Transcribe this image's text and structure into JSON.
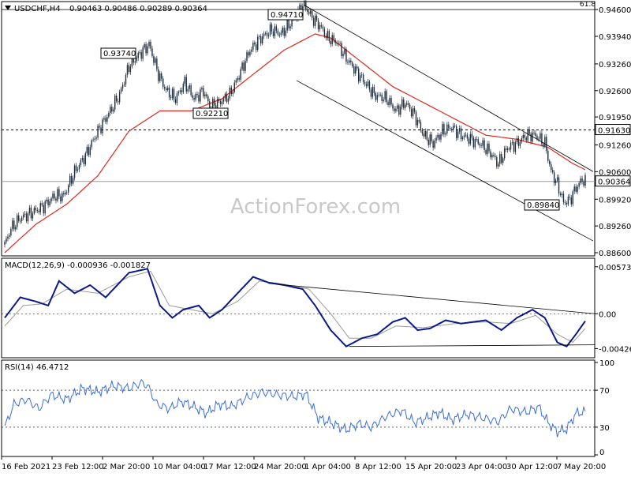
{
  "header": {
    "symbol": "USDCHF,H4",
    "ohlc": "0.90463 0.90486 0.90289 0.90364"
  },
  "watermark": "ActionForex.com",
  "colors": {
    "candles": "#1f2d3d",
    "ma": "#e0281e",
    "macd": "#0b1a8a",
    "signal": "#9a9a9a",
    "rsi": "#3a6fd8",
    "trend": "#000000",
    "grid": "#000000"
  },
  "price_panel": {
    "y_ticks": [
      "0.94600",
      "0.93940",
      "0.93260",
      "0.92600",
      "0.91950",
      "0.91260",
      "0.90600",
      "0.89920",
      "0.89260",
      "0.88600"
    ],
    "current_price": "0.90364",
    "level_label": "0.91630",
    "fib_label": "61.8",
    "annotations": [
      "0.94710",
      "0.93740",
      "0.92210",
      "0.89840"
    ]
  },
  "macd_panel": {
    "label": "MACD(12,26,9) -0.000936 -0.001827",
    "y_ticks": [
      "0.005739",
      "0.00",
      "-0.004261"
    ]
  },
  "rsi_panel": {
    "label": "RSI(14) 46.4712",
    "y_ticks": [
      "100",
      "70",
      "30",
      "0"
    ]
  },
  "x_labels": [
    "16 Feb 2021",
    "23 Feb 12:00",
    "2 Mar 20:00",
    "10 Mar 04:00",
    "17 Mar 12:00",
    "24 Mar 20:00",
    "1 Apr 04:00",
    "8 Apr 12:00",
    "15 Apr 20:00",
    "23 Apr 04:00",
    "30 Apr 12:00",
    "7 May 20:00"
  ],
  "chart_data": {
    "type": "candlestick",
    "price_axis": {
      "min": 0.886,
      "max": 0.9471
    },
    "price_anchors": [
      [
        0,
        0.888
      ],
      [
        4,
        0.892
      ],
      [
        10,
        0.8945
      ],
      [
        18,
        0.896
      ],
      [
        25,
        0.8975
      ],
      [
        32,
        0.9
      ],
      [
        38,
        0.9
      ],
      [
        45,
        0.906
      ],
      [
        52,
        0.91
      ],
      [
        60,
        0.916
      ],
      [
        68,
        0.921
      ],
      [
        74,
        0.925
      ],
      [
        80,
        0.932
      ],
      [
        88,
        0.9355
      ],
      [
        93,
        0.9374
      ],
      [
        99,
        0.93
      ],
      [
        104,
        0.926
      ],
      [
        110,
        0.924
      ],
      [
        116,
        0.928
      ],
      [
        122,
        0.924
      ],
      [
        128,
        0.926
      ],
      [
        132,
        0.9221
      ],
      [
        138,
        0.923
      ],
      [
        145,
        0.925
      ],
      [
        150,
        0.929
      ],
      [
        158,
        0.936
      ],
      [
        165,
        0.939
      ],
      [
        172,
        0.941
      ],
      [
        178,
        0.94
      ],
      [
        185,
        0.943
      ],
      [
        190,
        0.946
      ],
      [
        193,
        0.9471
      ],
      [
        198,
        0.944
      ],
      [
        203,
        0.942
      ],
      [
        208,
        0.939
      ],
      [
        214,
        0.938
      ],
      [
        220,
        0.934
      ],
      [
        226,
        0.931
      ],
      [
        232,
        0.928
      ],
      [
        238,
        0.925
      ],
      [
        246,
        0.924
      ],
      [
        252,
        0.921
      ],
      [
        258,
        0.923
      ],
      [
        264,
        0.92
      ],
      [
        270,
        0.915
      ],
      [
        276,
        0.913
      ],
      [
        282,
        0.916
      ],
      [
        288,
        0.917
      ],
      [
        294,
        0.915
      ],
      [
        300,
        0.914
      ],
      [
        306,
        0.913
      ],
      [
        312,
        0.911
      ],
      [
        318,
        0.908
      ],
      [
        324,
        0.912
      ],
      [
        330,
        0.913
      ],
      [
        336,
        0.915
      ],
      [
        342,
        0.915
      ],
      [
        348,
        0.913
      ],
      [
        352,
        0.906
      ],
      [
        356,
        0.903
      ],
      [
        360,
        0.8984
      ],
      [
        364,
        0.899
      ],
      [
        368,
        0.902
      ],
      [
        372,
        0.904
      ],
      [
        374,
        0.9036
      ]
    ],
    "moving_average_anchors": [
      [
        0,
        0.886
      ],
      [
        20,
        0.893
      ],
      [
        40,
        0.898
      ],
      [
        60,
        0.905
      ],
      [
        80,
        0.916
      ],
      [
        100,
        0.921
      ],
      [
        120,
        0.921
      ],
      [
        140,
        0.924
      ],
      [
        160,
        0.93
      ],
      [
        180,
        0.936
      ],
      [
        200,
        0.94
      ],
      [
        210,
        0.939
      ],
      [
        230,
        0.933
      ],
      [
        250,
        0.927
      ],
      [
        270,
        0.923
      ],
      [
        290,
        0.919
      ],
      [
        310,
        0.915
      ],
      [
        330,
        0.914
      ],
      [
        350,
        0.912
      ],
      [
        366,
        0.908
      ],
      [
        374,
        0.9065
      ]
    ],
    "horizontal_levels": [
      0.9163,
      0.9036,
      0.946
    ],
    "macd_axis": {
      "min": -0.004261,
      "max": 0.005739
    },
    "macd_anchors": [
      [
        0,
        -0.0005
      ],
      [
        10,
        0.002
      ],
      [
        20,
        0.0015
      ],
      [
        28,
        0.001
      ],
      [
        35,
        0.004
      ],
      [
        45,
        0.0025
      ],
      [
        55,
        0.0035
      ],
      [
        65,
        0.002
      ],
      [
        80,
        0.005
      ],
      [
        92,
        0.0055
      ],
      [
        100,
        0.001
      ],
      [
        108,
        -0.0005
      ],
      [
        115,
        0.0005
      ],
      [
        125,
        0.001
      ],
      [
        132,
        -0.0005
      ],
      [
        140,
        0.0005
      ],
      [
        150,
        0.0025
      ],
      [
        160,
        0.0045
      ],
      [
        170,
        0.0038
      ],
      [
        180,
        0.0035
      ],
      [
        192,
        0.003
      ],
      [
        200,
        0.001
      ],
      [
        210,
        -0.002
      ],
      [
        220,
        -0.004
      ],
      [
        230,
        -0.003
      ],
      [
        240,
        -0.0025
      ],
      [
        250,
        -0.001
      ],
      [
        258,
        -0.0005
      ],
      [
        266,
        -0.002
      ],
      [
        274,
        -0.0018
      ],
      [
        284,
        -0.0008
      ],
      [
        294,
        -0.0012
      ],
      [
        302,
        -0.001
      ],
      [
        310,
        -0.0008
      ],
      [
        320,
        -0.002
      ],
      [
        330,
        -0.0005
      ],
      [
        340,
        0.0005
      ],
      [
        348,
        -0.0005
      ],
      [
        356,
        -0.0035
      ],
      [
        362,
        -0.004
      ],
      [
        368,
        -0.0025
      ],
      [
        374,
        -0.0009
      ]
    ],
    "signal_anchors": [
      [
        0,
        -0.0015
      ],
      [
        12,
        0.001
      ],
      [
        24,
        0.0012
      ],
      [
        40,
        0.003
      ],
      [
        60,
        0.0025
      ],
      [
        80,
        0.0045
      ],
      [
        94,
        0.0052
      ],
      [
        106,
        0.001
      ],
      [
        120,
        0.0005
      ],
      [
        134,
        0.0
      ],
      [
        150,
        0.0015
      ],
      [
        164,
        0.004
      ],
      [
        180,
        0.0036
      ],
      [
        196,
        0.003
      ],
      [
        210,
        0.0
      ],
      [
        222,
        -0.003
      ],
      [
        236,
        -0.003
      ],
      [
        252,
        -0.0015
      ],
      [
        270,
        -0.0017
      ],
      [
        290,
        -0.0012
      ],
      [
        310,
        -0.001
      ],
      [
        326,
        -0.0012
      ],
      [
        342,
        -0.0002
      ],
      [
        356,
        -0.0025
      ],
      [
        366,
        -0.0035
      ],
      [
        374,
        -0.0018
      ]
    ],
    "rsi_axis": {
      "min": 0,
      "max": 100
    },
    "rsi_anchors": [
      [
        0,
        30
      ],
      [
        6,
        55
      ],
      [
        14,
        60
      ],
      [
        22,
        50
      ],
      [
        30,
        65
      ],
      [
        40,
        60
      ],
      [
        50,
        72
      ],
      [
        60,
        68
      ],
      [
        70,
        75
      ],
      [
        80,
        72
      ],
      [
        88,
        78
      ],
      [
        92,
        75
      ],
      [
        98,
        55
      ],
      [
        106,
        50
      ],
      [
        114,
        58
      ],
      [
        122,
        52
      ],
      [
        130,
        45
      ],
      [
        138,
        55
      ],
      [
        146,
        52
      ],
      [
        156,
        62
      ],
      [
        166,
        68
      ],
      [
        176,
        65
      ],
      [
        186,
        63
      ],
      [
        194,
        66
      ],
      [
        202,
        40
      ],
      [
        210,
        35
      ],
      [
        220,
        27
      ],
      [
        228,
        34
      ],
      [
        236,
        30
      ],
      [
        246,
        42
      ],
      [
        256,
        48
      ],
      [
        264,
        35
      ],
      [
        272,
        40
      ],
      [
        280,
        46
      ],
      [
        288,
        38
      ],
      [
        298,
        44
      ],
      [
        308,
        40
      ],
      [
        318,
        36
      ],
      [
        326,
        50
      ],
      [
        336,
        46
      ],
      [
        344,
        52
      ],
      [
        350,
        35
      ],
      [
        356,
        25
      ],
      [
        362,
        28
      ],
      [
        368,
        45
      ],
      [
        374,
        46.47
      ]
    ],
    "channel_lines": [
      {
        "from": [
          193,
          0.9471
        ],
        "to": [
          374,
          0.907
        ]
      },
      {
        "from": [
          188,
          0.9285
        ],
        "to": [
          374,
          0.8895
        ]
      }
    ],
    "macd_trendlines": [
      {
        "from": [
          170,
          0.0037
        ],
        "to": [
          374,
          0.0
        ]
      },
      {
        "from": [
          222,
          -0.004
        ],
        "to": [
          374,
          -0.0038
        ]
      }
    ],
    "rsi_levels": [
      70,
      30
    ]
  }
}
